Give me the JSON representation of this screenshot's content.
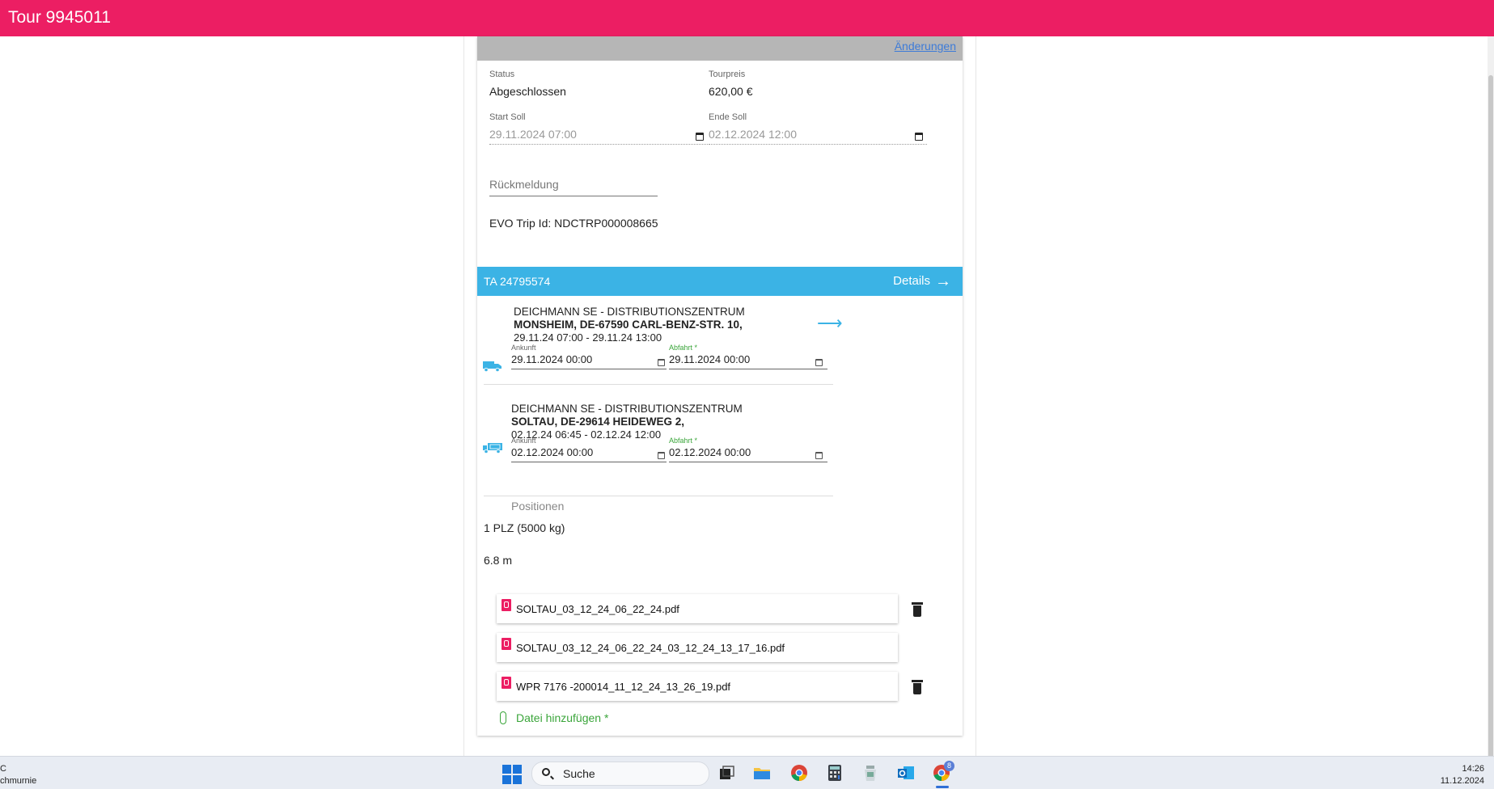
{
  "header": {
    "title": "Tour 9945011"
  },
  "card": {
    "changes_link": "Änderungen",
    "status_label": "Status",
    "status_value": "Abgeschlossen",
    "price_label": "Tourpreis",
    "price_value": "620,00 €",
    "start_label": "Start Soll",
    "start_value": "29.11.2024 07:00",
    "end_label": "Ende Soll",
    "end_value": "02.12.2024 12:00",
    "feedback_placeholder": "Rückmeldung",
    "evo": "EVO Trip Id: NDCTRP000008665"
  },
  "order": {
    "id": "TA 24795574",
    "details_label": "Details",
    "stops": [
      {
        "name": "DEICHMANN SE - DISTRIBUTIONSZENTRUM",
        "address": "MONSHEIM, DE-67590 CARL-BENZ-STR. 10,",
        "window": "29.11.24 07:00 - 29.11.24 13:00",
        "arrival_label": "Ankunft",
        "arrival_value": "29.11.2024 00:00",
        "departure_label": "Abfahrt *",
        "departure_value": "29.11.2024 00:00"
      },
      {
        "name": "DEICHMANN SE - DISTRIBUTIONSZENTRUM",
        "address": "SOLTAU, DE-29614 HEIDEWEG 2,",
        "window": "02.12.24 06:45 - 02.12.24 12:00",
        "arrival_label": "Ankunft",
        "arrival_value": "02.12.2024 00:00",
        "departure_label": "Abfahrt *",
        "departure_value": "02.12.2024 00:00"
      }
    ],
    "positions_label": "Positionen",
    "positions": [
      "1 PLZ (5000 kg)",
      "6.8 m"
    ],
    "files": [
      {
        "name": "SOLTAU_03_12_24_06_22_24.pdf"
      },
      {
        "name": "SOLTAU_03_12_24_06_22_24_03_12_24_13_17_16.pdf"
      },
      {
        "name": "WPR 7176 -200014_11_12_24_13_26_19.pdf"
      }
    ],
    "add_file": "Datei hinzufügen *"
  },
  "taskbar": {
    "left_line1": "C",
    "left_line2": "chmurnie",
    "search": "Suche",
    "badge": "8",
    "time": "14:26",
    "date": "11.12.2024"
  },
  "colors": {
    "brand": "#ec1e63",
    "accent": "#3bb3e5",
    "success": "#3aa53a"
  }
}
